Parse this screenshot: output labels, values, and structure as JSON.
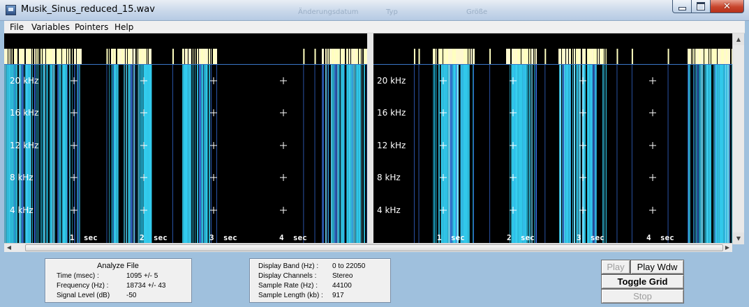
{
  "window": {
    "title": "Musik_Sinus_reduced_15.wav",
    "ghost_texts": [
      "Änderungsdatum",
      "Typ",
      "Größe"
    ]
  },
  "menu": [
    "File",
    "Variables",
    "Pointers",
    "Help"
  ],
  "spectrogram": {
    "channels": [
      {
        "name": "left",
        "frequency_labels": [
          "20 kHz",
          "16 kHz",
          "12 kHz",
          "8  kHz",
          "4  kHz"
        ],
        "time_labels": [
          "1  sec",
          "2  sec",
          "3  sec",
          "4  sec"
        ]
      },
      {
        "name": "right",
        "frequency_labels": [
          "20 kHz",
          "16 kHz",
          "12 kHz",
          "8  kHz",
          "4  kHz"
        ],
        "time_labels": [
          "1  sec",
          "2  sec",
          "3  sec",
          "4  sec"
        ]
      }
    ],
    "colors": {
      "background": "#000000",
      "activity": "#ffffc0",
      "cyan": "#33ccee",
      "blue": "#3366cc",
      "grid": "#ffffff"
    }
  },
  "analyze_panel": {
    "header": "Analyze File",
    "rows": [
      {
        "label": "Time (msec) :",
        "value": "1095 +/- 5"
      },
      {
        "label": "Frequency (Hz) :",
        "value": "18734 +/- 43"
      },
      {
        "label": "Signal Level (dB)",
        "value": "-50"
      }
    ]
  },
  "display_panel": {
    "rows": [
      {
        "label": "Display Band (Hz) :",
        "value": "0 to 22050"
      },
      {
        "label": "Display Channels :",
        "value": "Stereo"
      },
      {
        "label": "Sample Rate (Hz) :",
        "value": "44100"
      },
      {
        "label": "Sample Length (kb) :",
        "value": "917"
      }
    ]
  },
  "buttons": {
    "play": "Play",
    "play_wdw": "Play Wdw",
    "toggle_grid": "Toggle Grid",
    "stop": "Stop"
  }
}
